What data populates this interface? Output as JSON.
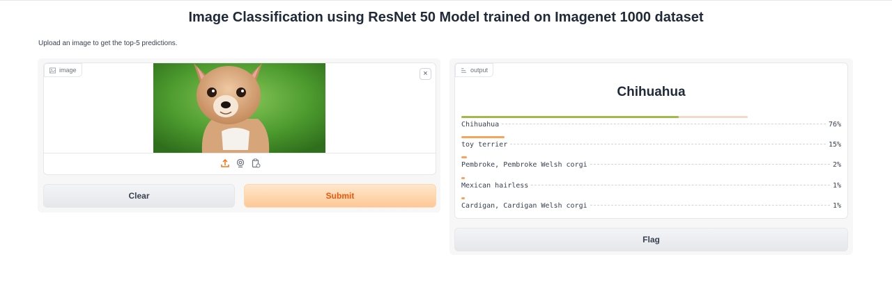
{
  "header": {
    "title": "Image Classification using ResNet 50 Model trained on Imagenet 1000 dataset",
    "description": "Upload an image to get the top-5 predictions."
  },
  "input": {
    "label": "image",
    "label_icon": "image-icon",
    "close_icon": "close-icon",
    "close_glyph": "×",
    "image_subject": "Chihuahua dog on grass",
    "tool_icons": [
      "upload-icon",
      "webcam-icon",
      "clipboard-icon"
    ]
  },
  "buttons": {
    "clear": "Clear",
    "submit": "Submit",
    "flag": "Flag"
  },
  "output": {
    "label": "output",
    "label_icon": "label-icon",
    "top_label": "Chihuahua",
    "confidences": [
      {
        "label": "Chihuahua",
        "percent": "76%",
        "value": 0.76
      },
      {
        "label": "toy terrier",
        "percent": "15%",
        "value": 0.15
      },
      {
        "label": "Pembroke, Pembroke Welsh corgi",
        "percent": "2%",
        "value": 0.02
      },
      {
        "label": "Mexican hairless",
        "percent": "1%",
        "value": 0.01
      },
      {
        "label": "Cardigan, Cardigan Welsh corgi",
        "percent": "1%",
        "value": 0.01
      }
    ]
  },
  "colors": {
    "accent": "#f97316",
    "top_bar": "#a3b84a",
    "bar": "#f6a35c",
    "track": "#f3d9c6"
  }
}
